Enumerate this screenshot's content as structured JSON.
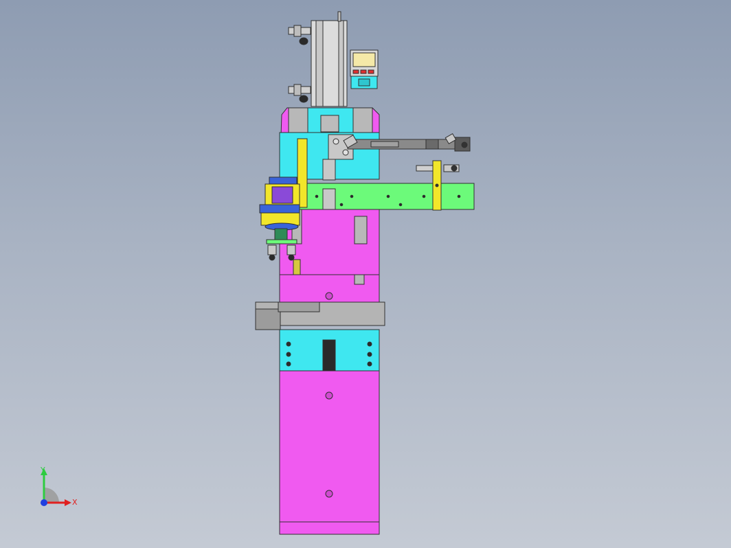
{
  "colors": {
    "background_top": "#8e9cb2",
    "background_bottom": "#c4cad4",
    "magenta": "#f05af0",
    "cyan": "#3fe7f0",
    "green": "#6cfa7a",
    "yellow": "#f2e62a",
    "grey": "#b4b4b4",
    "dark_grey": "#8a8a8a",
    "blue": "#3a63d8",
    "outline": "#303030",
    "display_red": "#e03030",
    "display_screen": "#f5e9a8"
  },
  "triad": {
    "y_label": "Y",
    "x_label": "X",
    "y_color": "#2ecc40",
    "x_color": "#e02020",
    "z_color": "#2040e0"
  }
}
